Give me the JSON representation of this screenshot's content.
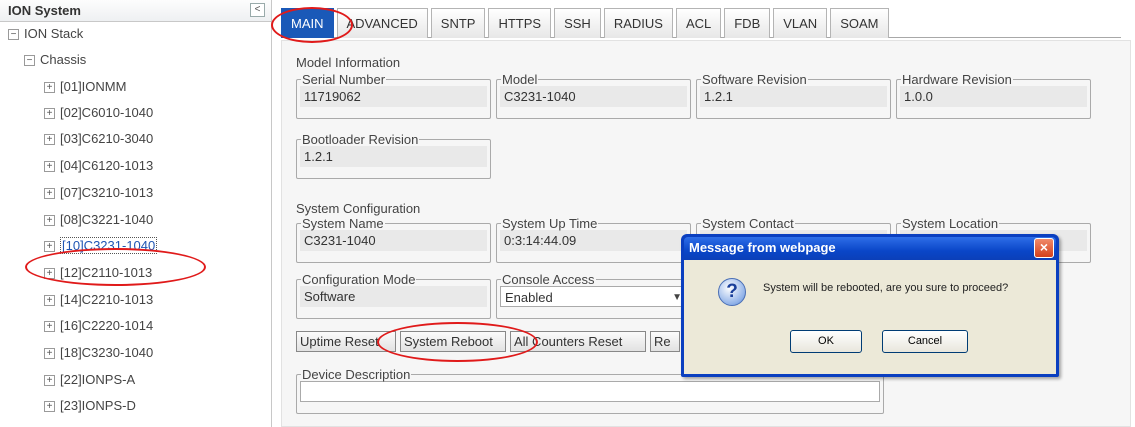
{
  "sidebar": {
    "title": "ION System",
    "collapse_label": "<",
    "root": {
      "toggle": "−",
      "label": "ION Stack"
    },
    "chassis": {
      "toggle": "−",
      "label": "Chassis"
    },
    "items": [
      {
        "toggle": "+",
        "label": "[01]IONMM"
      },
      {
        "toggle": "+",
        "label": "[02]C6010-1040"
      },
      {
        "toggle": "+",
        "label": "[03]C6210-3040"
      },
      {
        "toggle": "+",
        "label": "[04]C6120-1013"
      },
      {
        "toggle": "+",
        "label": "[07]C3210-1013"
      },
      {
        "toggle": "+",
        "label": "[08]C3221-1040"
      },
      {
        "toggle": "+",
        "label": "[10]C3231-1040"
      },
      {
        "toggle": "+",
        "label": "[12]C2110-1013"
      },
      {
        "toggle": "+",
        "label": "[14]C2210-1013"
      },
      {
        "toggle": "+",
        "label": "[16]C2220-1014"
      },
      {
        "toggle": "+",
        "label": "[18]C3230-1040"
      },
      {
        "toggle": "+",
        "label": "[22]IONPS-A"
      },
      {
        "toggle": "+",
        "label": "[23]IONPS-D"
      }
    ],
    "selected_label": "[10]C3231-1040"
  },
  "tabs": [
    "MAIN",
    "ADVANCED",
    "SNTP",
    "HTTPS",
    "SSH",
    "RADIUS",
    "ACL",
    "FDB",
    "VLAN",
    "SOAM"
  ],
  "active_tab": "MAIN",
  "model_info": {
    "title": "Model Information",
    "serial_label": "Serial Number",
    "serial_value": "11719062",
    "model_label": "Model",
    "model_value": "C3231-1040",
    "sw_label": "Software Revision",
    "sw_value": "1.2.1",
    "hw_label": "Hardware Revision",
    "hw_value": "1.0.0",
    "boot_label": "Bootloader Revision",
    "boot_value": "1.2.1"
  },
  "sys_config": {
    "title": "System Configuration",
    "name_label": "System Name",
    "name_value": "C3231-1040",
    "uptime_label": "System Up Time",
    "uptime_value": "0:3:14:44.09",
    "contact_label": "System Contact",
    "location_label": "System Location",
    "config_mode_label": "Configuration Mode",
    "config_mode_value": "Software",
    "console_label": "Console Access",
    "console_value": "Enabled",
    "desc_label": "Device Description",
    "desc_value": ""
  },
  "buttons": {
    "uptime_reset": "Uptime Reset",
    "system_reboot": "System Reboot",
    "all_counters_reset": "All Counters Reset",
    "re": "Re"
  },
  "dialog": {
    "title": "Message from webpage",
    "message": "System will be rebooted, are you sure to proceed?",
    "ok": "OK",
    "cancel": "Cancel",
    "close": "×",
    "icon": "?"
  },
  "colors": {
    "active_tab": "#1a59b8",
    "highlight": "#e01a1a",
    "dialog_frame": "#0a3fc0"
  }
}
